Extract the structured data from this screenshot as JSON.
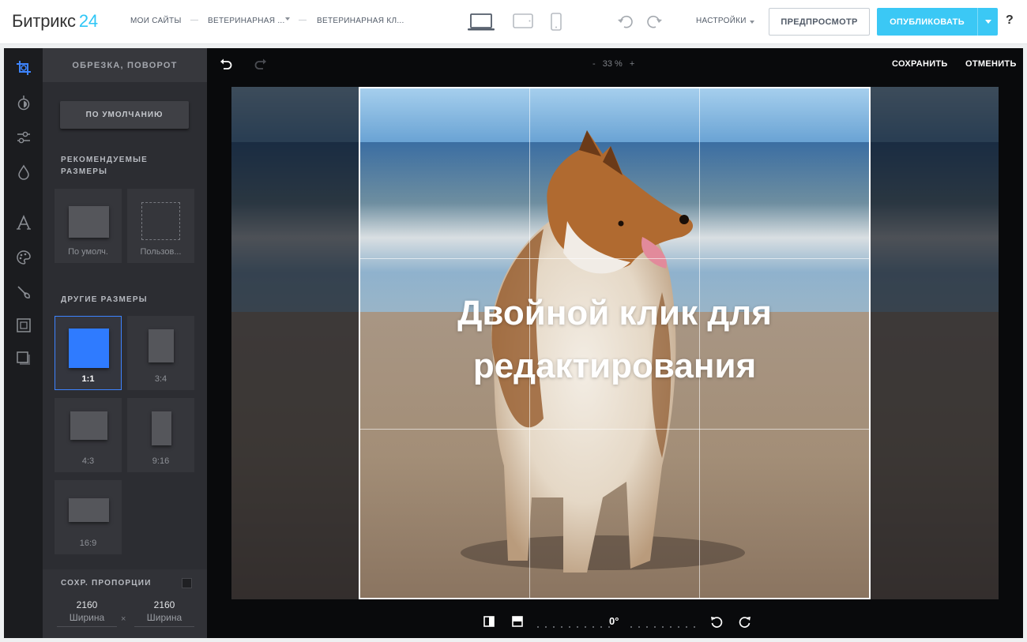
{
  "header": {
    "logo_text": "Битрикс",
    "logo_num": "24",
    "breadcrumbs": [
      "МОИ САЙТЫ",
      "ВЕТЕРИНАРНАЯ ...",
      "ВЕТЕРИНАРНАЯ КЛ..."
    ],
    "settings_label": "НАСТРОЙКИ",
    "preview_label": "ПРЕДПРОСМОТР",
    "publish_label": "ОПУБЛИКОВАТЬ",
    "help_label": "?",
    "accent_color": "#3bc8f5"
  },
  "panel": {
    "title": "ОБРЕЗКА, ПОВОРОТ",
    "default_button": "ПО УМОЛЧАНИЮ",
    "recommended_title": "РЕКОМЕНДУЕМЫЕ РАЗМЕРЫ",
    "recommended": [
      {
        "label": "По умолч."
      },
      {
        "label": "Пользов..."
      }
    ],
    "other_title": "ДРУГИЕ РАЗМЕРЫ",
    "other": [
      {
        "label": "1:1",
        "active": true
      },
      {
        "label": "3:4",
        "active": false
      },
      {
        "label": "4:3",
        "active": false
      },
      {
        "label": "9:16",
        "active": false
      },
      {
        "label": "16:9",
        "active": false
      }
    ],
    "keep_ratio_label": "СОХР. ПРОПОРЦИИ",
    "keep_ratio_checked": false,
    "width": {
      "value": "2160",
      "caption": "Ширина"
    },
    "height": {
      "value": "2160",
      "caption": "Ширина"
    },
    "separator": "×"
  },
  "canvas": {
    "zoom_minus": "-",
    "zoom": "33 %",
    "zoom_plus": "+",
    "save_label": "СОХРАНИТЬ",
    "cancel_label": "ОТМЕНИТЬ",
    "overlay_text": "Двойной клик для редактирования",
    "angle": "0°"
  },
  "icons": [
    "crop-icon",
    "brightness-icon",
    "adjust-icon",
    "drop-icon",
    "text-icon",
    "palette-icon",
    "brush-icon",
    "frame-icon",
    "shadow-icon",
    "laptop-icon",
    "tablet-icon",
    "phone-icon",
    "undo-icon",
    "redo-icon",
    "flip-horizontal-icon",
    "flip-vertical-icon",
    "rotate-left-icon",
    "rotate-right-icon"
  ]
}
